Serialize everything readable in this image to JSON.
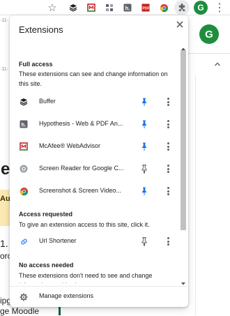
{
  "page_background": {
    "avatar_letter": "G",
    "left_text_1": "e",
    "left_text_2": "Au",
    "left_text_3": "1.",
    "left_text_4": "oro",
    "left_text_5": "ge Moodle",
    "left_text_6": "ipg",
    "ruler_text": "·11·"
  },
  "toolbar": {
    "avatar_letter": "G"
  },
  "popup": {
    "title": "Extensions",
    "close_label": "×",
    "sections": {
      "full_access": {
        "title": "Full access",
        "description": "These extensions can see and change information on this site."
      },
      "access_requested": {
        "title": "Access requested",
        "description": "To give an extension access to this site, click it."
      },
      "no_access": {
        "title": "No access needed",
        "description": "These extensions don't need to see and change information on this site."
      }
    },
    "extensions": [
      {
        "name": "Buffer",
        "icon": "buffer-icon",
        "pinned": true
      },
      {
        "name": "Hypothesis - Web & PDF An...",
        "icon": "hypothesis-icon",
        "pinned": true
      },
      {
        "name": "McAfee® WebAdvisor",
        "icon": "mcafee-icon",
        "pinned": true
      },
      {
        "name": "Screen Reader for Google C...",
        "icon": "screen-reader-icon",
        "pinned": false
      },
      {
        "name": "Screenshot & Screen Video...",
        "icon": "screenshot-icon",
        "pinned": true
      },
      {
        "name": "Url Shortener",
        "icon": "link-icon",
        "pinned": false
      }
    ],
    "footer": {
      "label": "Manage extensions",
      "icon": "gear-icon"
    }
  },
  "colors": {
    "pinned": "#1a73e8",
    "unpinned": "#5f6368",
    "avatar": "#1e8e3e",
    "link_icon": "#4285f4"
  }
}
